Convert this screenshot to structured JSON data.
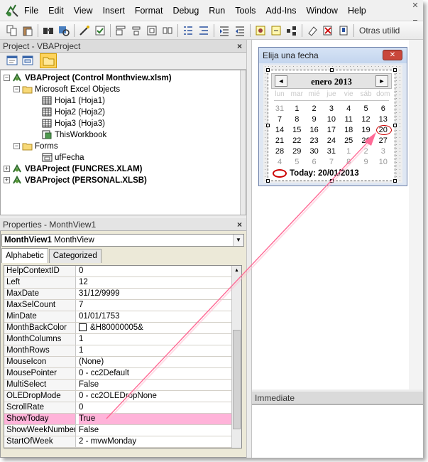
{
  "menu": [
    "File",
    "Edit",
    "View",
    "Insert",
    "Format",
    "Debug",
    "Run",
    "Tools",
    "Add-Ins",
    "Window",
    "Help"
  ],
  "toolbar": {
    "trailing_text": "Otras utilid"
  },
  "project": {
    "title": "Project - VBAProject",
    "close_glyph": "×",
    "tree": [
      {
        "label": "VBAProject (Control Monthview.xlsm)",
        "level": 0,
        "toggle": "−",
        "icon": "vba-project-icon",
        "bold": true
      },
      {
        "label": "Microsoft Excel Objects",
        "level": 1,
        "toggle": "−",
        "icon": "folder-open-icon",
        "bold": false
      },
      {
        "label": "Hoja1 (Hoja1)",
        "level": 2,
        "toggle": "",
        "icon": "sheet-icon",
        "bold": false
      },
      {
        "label": "Hoja2 (Hoja2)",
        "level": 2,
        "toggle": "",
        "icon": "sheet-icon",
        "bold": false
      },
      {
        "label": "Hoja3 (Hoja3)",
        "level": 2,
        "toggle": "",
        "icon": "sheet-icon",
        "bold": false
      },
      {
        "label": "ThisWorkbook",
        "level": 2,
        "toggle": "",
        "icon": "workbook-icon",
        "bold": false
      },
      {
        "label": "Forms",
        "level": 1,
        "toggle": "−",
        "icon": "folder-open-icon",
        "bold": false
      },
      {
        "label": "ufFecha",
        "level": 2,
        "toggle": "",
        "icon": "userform-icon",
        "bold": false
      },
      {
        "label": "VBAProject (FUNCRES.XLAM)",
        "level": 0,
        "toggle": "+",
        "icon": "vba-project-icon",
        "bold": true
      },
      {
        "label": "VBAProject (PERSONAL.XLSB)",
        "level": 0,
        "toggle": "+",
        "icon": "vba-project-icon",
        "bold": true
      }
    ]
  },
  "properties": {
    "title": "Properties - MonthView1",
    "close_glyph": "×",
    "object_name": "MonthView1",
    "object_type": "MonthView",
    "tabs": [
      "Alphabetic",
      "Categorized"
    ],
    "active_tab": 0,
    "rows": [
      {
        "name": "HelpContextID",
        "value": "0",
        "highlight": false
      },
      {
        "name": "Left",
        "value": "12",
        "highlight": false
      },
      {
        "name": "MaxDate",
        "value": "31/12/9999",
        "highlight": false
      },
      {
        "name": "MaxSelCount",
        "value": "7",
        "highlight": false
      },
      {
        "name": "MinDate",
        "value": "01/01/1753",
        "highlight": false
      },
      {
        "name": "MonthBackColor",
        "value": "&H80000005&",
        "swatch": "#ffffff",
        "highlight": false
      },
      {
        "name": "MonthColumns",
        "value": "1",
        "highlight": false
      },
      {
        "name": "MonthRows",
        "value": "1",
        "highlight": false
      },
      {
        "name": "MouseIcon",
        "value": "(None)",
        "highlight": false
      },
      {
        "name": "MousePointer",
        "value": "0 - cc2Default",
        "highlight": false
      },
      {
        "name": "MultiSelect",
        "value": "False",
        "highlight": false
      },
      {
        "name": "OLEDropMode",
        "value": "0 - cc2OLEDropNone",
        "highlight": false
      },
      {
        "name": "ScrollRate",
        "value": "0",
        "highlight": false
      },
      {
        "name": "ShowToday",
        "value": "True",
        "highlight": true
      },
      {
        "name": "ShowWeekNumbers",
        "value": "False",
        "highlight": false
      },
      {
        "name": "StartOfWeek",
        "value": "2 - mvwMonday",
        "highlight": false
      }
    ]
  },
  "userform": {
    "title": "Elija una fecha",
    "close_glyph": "✕",
    "calendar": {
      "month_label": "enero 2013",
      "prev_glyph": "◄",
      "next_glyph": "►",
      "weekdays": [
        "lun",
        "mar",
        "mié",
        "jue",
        "vie",
        "sáb",
        "dom"
      ],
      "weeks": [
        [
          "31",
          "1",
          "2",
          "3",
          "4",
          "5",
          "6"
        ],
        [
          "7",
          "8",
          "9",
          "10",
          "11",
          "12",
          "13"
        ],
        [
          "14",
          "15",
          "16",
          "17",
          "18",
          "19",
          "20"
        ],
        [
          "21",
          "22",
          "23",
          "24",
          "25",
          "26",
          "27"
        ],
        [
          "28",
          "29",
          "30",
          "31",
          "1",
          "2",
          "3"
        ],
        [
          "4",
          "5",
          "6",
          "7",
          "8",
          "9",
          "10"
        ]
      ],
      "today_text": "Today: 20/01/2013"
    }
  },
  "immediate": {
    "title": "Immediate"
  },
  "colors": {
    "highlight": "#ffb3d9",
    "annotation_arrow": "#ff6a96",
    "today_ring": "#cc0000"
  }
}
